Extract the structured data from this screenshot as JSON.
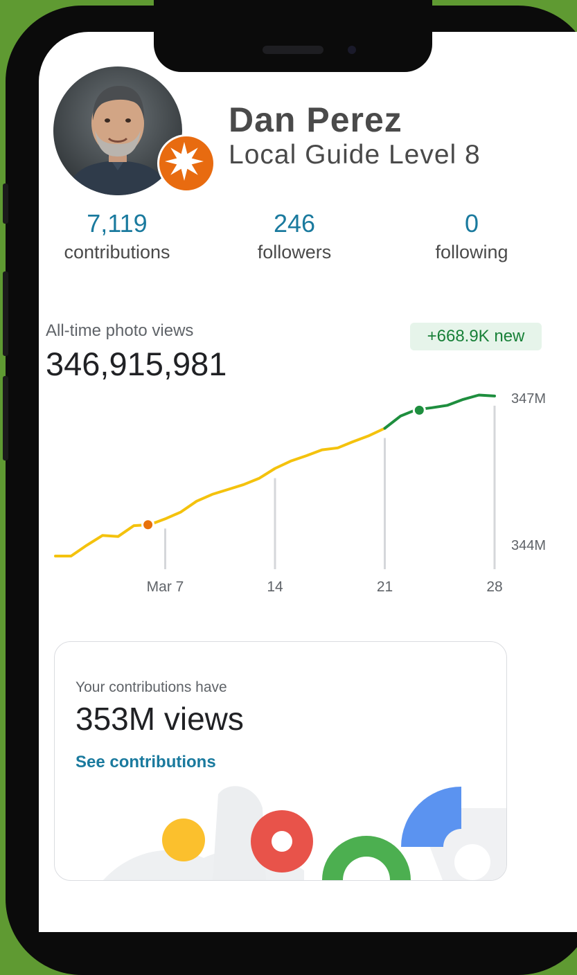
{
  "profile": {
    "name": "Dan Perez",
    "level": "Local Guide Level 8"
  },
  "stats": [
    {
      "value": "7,119",
      "label": "contributions"
    },
    {
      "value": "246",
      "label": "followers"
    },
    {
      "value": "0",
      "label": "following"
    }
  ],
  "photo_views": {
    "label": "All-time photo views",
    "value": "346,915,981",
    "new_badge": "+668.9K new"
  },
  "chart_data": {
    "type": "line",
    "x": [
      0,
      1,
      2,
      3,
      4,
      5,
      6,
      7,
      8,
      9,
      10,
      11,
      12,
      13,
      14,
      15,
      16,
      17,
      18,
      19,
      20,
      21,
      22,
      23,
      24,
      25,
      26,
      27,
      28
    ],
    "x_tick_labels": [
      "Mar 7",
      "14",
      "21",
      "28"
    ],
    "x_tick_positions": [
      7,
      14,
      21,
      28
    ],
    "y_tick_labels": [
      "347M",
      "344M"
    ],
    "ylim": [
      344,
      347
    ],
    "series": [
      {
        "values": [
          343.76,
          343.76,
          343.98,
          344.18,
          344.16,
          344.38,
          344.4,
          344.52,
          344.66,
          344.88,
          345.02,
          345.12,
          345.22,
          345.35,
          345.55,
          345.7,
          345.81,
          345.93,
          345.97,
          346.1,
          346.22,
          346.37,
          346.62,
          346.75,
          346.79,
          346.84,
          346.96,
          347.05,
          347.03
        ],
        "colors": {
          "older": "#f4c20d",
          "recent": "#1e8e3e"
        },
        "recent_from_x": 21
      }
    ],
    "markers": [
      {
        "x": 5.9,
        "y": 344.4,
        "color": "#e8710a"
      },
      {
        "x": 23.2,
        "y": 346.74,
        "color": "#1e8e3e"
      }
    ],
    "grid": false
  },
  "card": {
    "subtitle": "Your contributions have",
    "headline": "353M views",
    "link": "See contributions"
  }
}
